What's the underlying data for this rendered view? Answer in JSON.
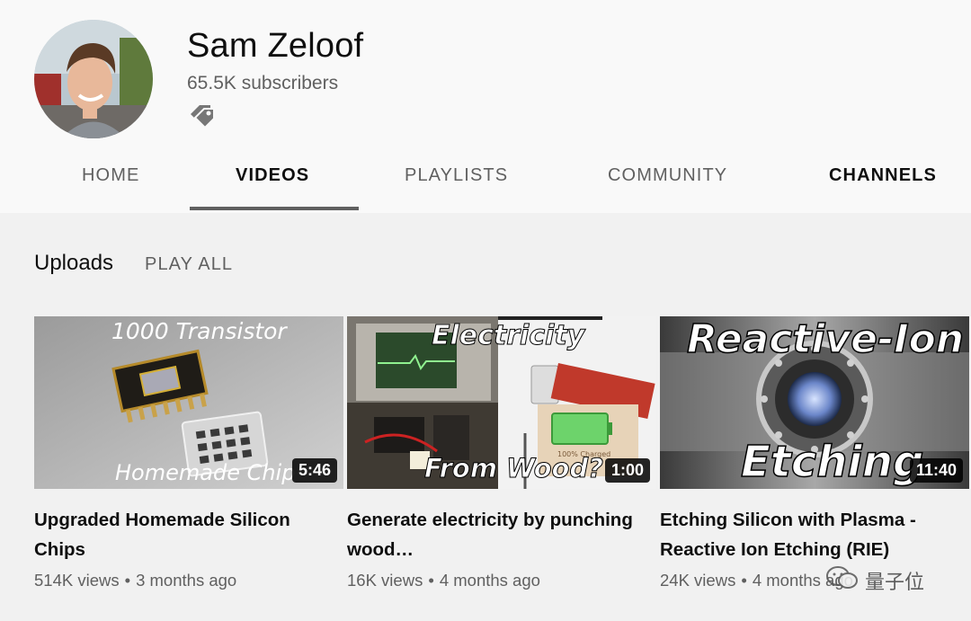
{
  "channel": {
    "name": "Sam Zeloof",
    "subscribers": "65.5K subscribers"
  },
  "tabs": [
    {
      "label": "HOME"
    },
    {
      "label": "VIDEOS"
    },
    {
      "label": "PLAYLISTS"
    },
    {
      "label": "COMMUNITY"
    },
    {
      "label": "CHANNELS"
    }
  ],
  "section": {
    "title": "Uploads",
    "play_all": "PLAY ALL"
  },
  "videos": [
    {
      "title": "Upgraded Homemade Silicon Chips",
      "views": "514K views",
      "age": "3 months ago",
      "duration": "5:46",
      "thumb_text_top": "1000 Transistor",
      "thumb_text_bottom": "Homemade Chip"
    },
    {
      "title": "Generate electricity by punching wood…",
      "views": "16K views",
      "age": "4 months ago",
      "duration": "1:00",
      "thumb_text_top": "Electricity",
      "thumb_text_bottom": "From Wood?",
      "thumb_small": "100% Charged"
    },
    {
      "title": "Etching Silicon with Plasma - Reactive Ion Etching (RIE)",
      "views": "24K views",
      "age": "4 months ago",
      "duration": "11:40",
      "thumb_text_top": "Reactive-Ion",
      "thumb_text_bottom": "Etching"
    }
  ],
  "watermark": "量子位",
  "icons": {
    "tag": "tag-icon",
    "watermark": "wechat-icon"
  }
}
